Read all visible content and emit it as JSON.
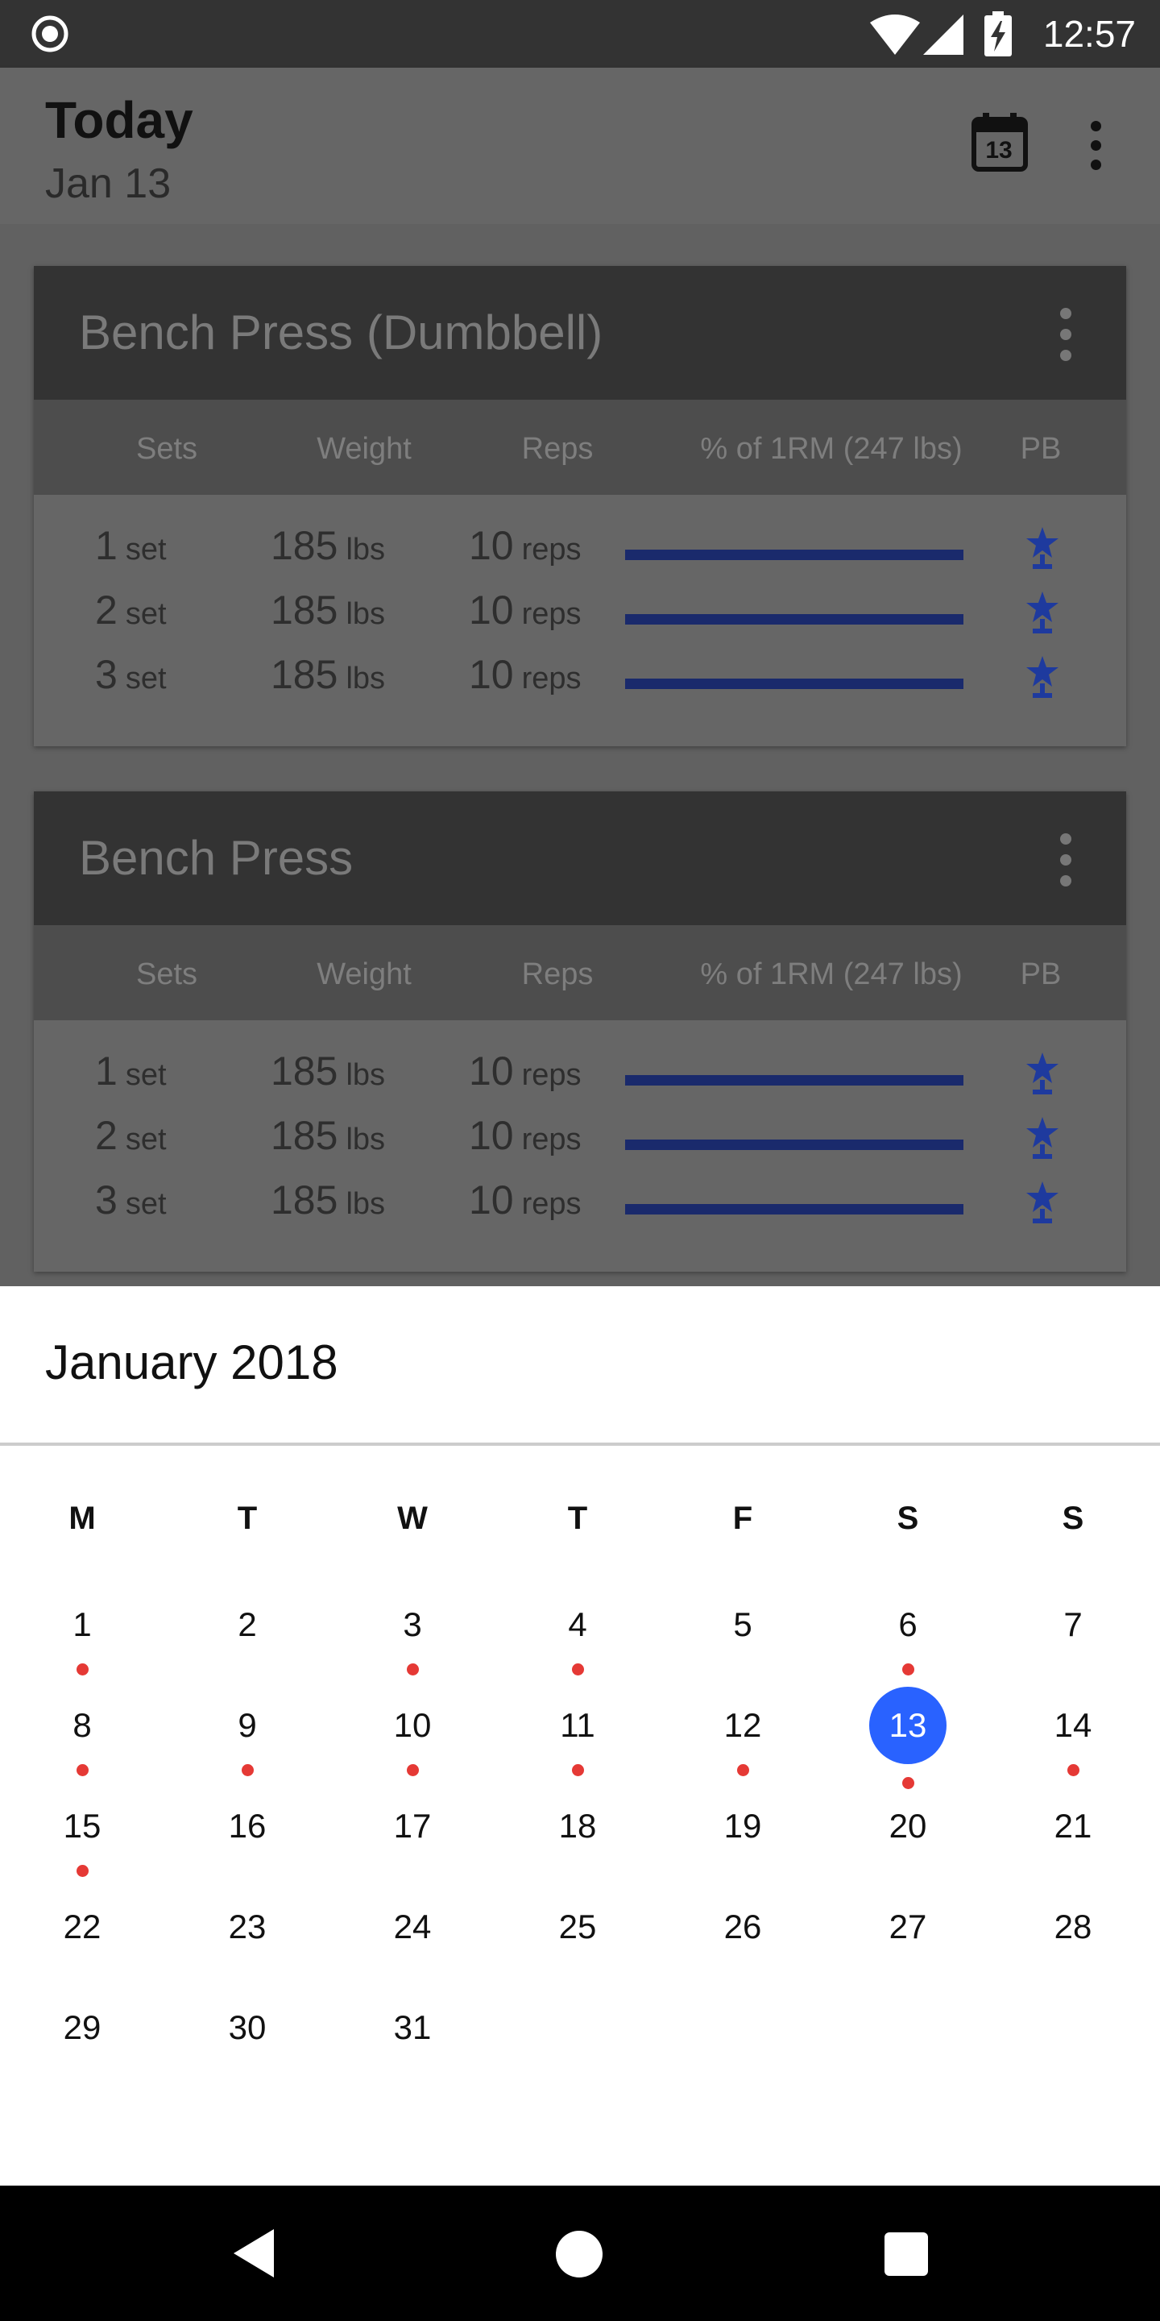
{
  "status_bar": {
    "time": "12:57",
    "icons": [
      "notification-icon",
      "wifi-icon",
      "signal-icon",
      "battery-charging-icon"
    ]
  },
  "app_bar": {
    "title": "Today",
    "subtitle": "Jan 13",
    "calendar_button_day": "13",
    "icons": [
      "calendar-icon",
      "more-vert-icon"
    ]
  },
  "columns": {
    "sets": "Sets",
    "weight": "Weight",
    "reps": "Reps",
    "one_rm": "% of 1RM (247 lbs)",
    "pb": "PB"
  },
  "cards": [
    {
      "title": "Bench Press (Dumbbell)",
      "rows": [
        {
          "set_num": "1",
          "set_unit": "set",
          "weight": "185",
          "weight_unit": "lbs",
          "reps": "10",
          "reps_unit": "reps",
          "one_rm_fraction": 0.75,
          "pb": true
        },
        {
          "set_num": "2",
          "set_unit": "set",
          "weight": "185",
          "weight_unit": "lbs",
          "reps": "10",
          "reps_unit": "reps",
          "one_rm_fraction": 0.75,
          "pb": true
        },
        {
          "set_num": "3",
          "set_unit": "set",
          "weight": "185",
          "weight_unit": "lbs",
          "reps": "10",
          "reps_unit": "reps",
          "one_rm_fraction": 0.75,
          "pb": true
        }
      ]
    },
    {
      "title": "Bench Press",
      "rows": [
        {
          "set_num": "1",
          "set_unit": "set",
          "weight": "185",
          "weight_unit": "lbs",
          "reps": "10",
          "reps_unit": "reps",
          "one_rm_fraction": 0.75,
          "pb": true
        },
        {
          "set_num": "2",
          "set_unit": "set",
          "weight": "185",
          "weight_unit": "lbs",
          "reps": "10",
          "reps_unit": "reps",
          "one_rm_fraction": 0.75,
          "pb": true
        },
        {
          "set_num": "3",
          "set_unit": "set",
          "weight": "185",
          "weight_unit": "lbs",
          "reps": "10",
          "reps_unit": "reps",
          "one_rm_fraction": 0.75,
          "pb": true
        }
      ]
    }
  ],
  "calendar": {
    "month_title": "January 2018",
    "weekdays": [
      "M",
      "T",
      "W",
      "T",
      "F",
      "S",
      "S"
    ],
    "days": [
      "1",
      "2",
      "3",
      "4",
      "5",
      "6",
      "7",
      "8",
      "9",
      "10",
      "11",
      "12",
      "13",
      "14",
      "15",
      "16",
      "17",
      "18",
      "19",
      "20",
      "21",
      "22",
      "23",
      "24",
      "25",
      "26",
      "27",
      "28",
      "29",
      "30",
      "31"
    ],
    "first_weekday_index": 0,
    "selected_day": "13",
    "event_days": [
      "1",
      "3",
      "4",
      "6",
      "8",
      "9",
      "10",
      "11",
      "12",
      "13",
      "14",
      "15"
    ],
    "selected_color": "#2962ff",
    "event_dot_color": "#e53935"
  },
  "nav_bar": {
    "icons": [
      "back-icon",
      "home-icon",
      "recents-icon"
    ]
  }
}
